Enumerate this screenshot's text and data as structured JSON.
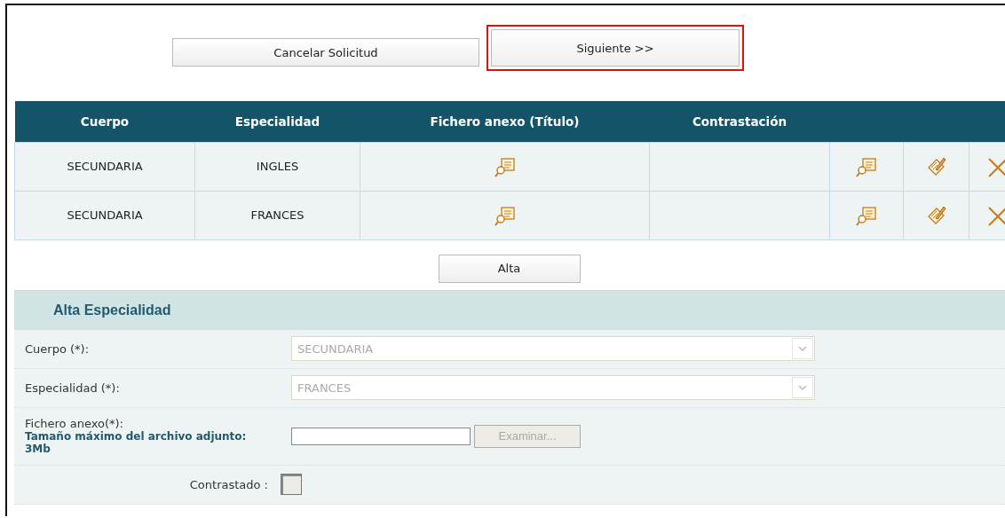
{
  "buttons": [
    {
      "label": "Cancelar Solicitud",
      "highlighted": false
    },
    {
      "label": "Siguiente >>",
      "highlighted": true
    }
  ],
  "table": {
    "columns": [
      "Cuerpo",
      "Especialidad",
      "Fichero anexo (Título)",
      "Contrastación"
    ],
    "rows": [
      {
        "cuerpo": "SECUNDARIA",
        "especialidad": "INGLES"
      },
      {
        "cuerpo": "SECUNDARIA",
        "especialidad": "FRANCES"
      }
    ]
  },
  "add_button": "Alta",
  "form": {
    "title": "Alta Especialidad",
    "fields": [
      {
        "kind": "select",
        "label": "Cuerpo (*):",
        "value": "SECUNDARIA",
        "disabled": true
      },
      {
        "kind": "select",
        "label": "Especialidad (*):",
        "value": "FRANCES",
        "disabled": true
      },
      {
        "kind": "file",
        "label": "Fichero anexo(*):",
        "note": "Tamaño máximo del archivo adjunto: 3Mb",
        "button": "Examinar...",
        "disabled": true
      },
      {
        "kind": "checkbox",
        "label": "Contrastado :",
        "checked": false,
        "disabled": true
      }
    ]
  }
}
